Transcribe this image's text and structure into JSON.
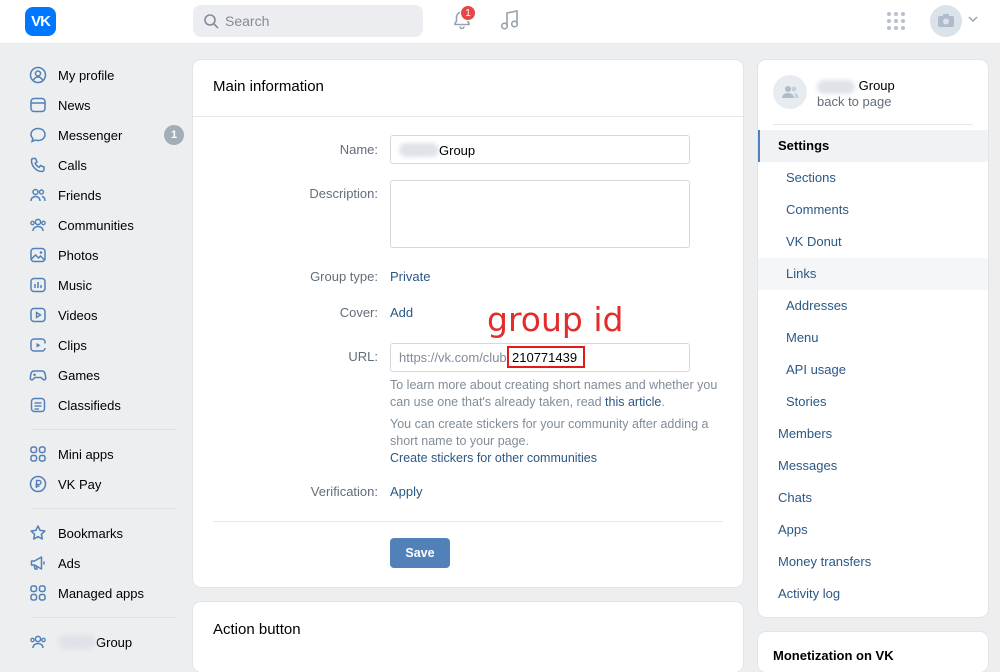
{
  "header": {
    "logo_text": "VK",
    "search_placeholder": "Search",
    "notifications_count": "1"
  },
  "leftnav": {
    "items": [
      {
        "label": "My profile",
        "icon": "profile-icon"
      },
      {
        "label": "News",
        "icon": "news-icon"
      },
      {
        "label": "Messenger",
        "icon": "messenger-icon",
        "count": "1"
      },
      {
        "label": "Calls",
        "icon": "phone-icon"
      },
      {
        "label": "Friends",
        "icon": "friends-icon"
      },
      {
        "label": "Communities",
        "icon": "communities-icon"
      },
      {
        "label": "Photos",
        "icon": "photos-icon"
      },
      {
        "label": "Music",
        "icon": "music-icon"
      },
      {
        "label": "Videos",
        "icon": "videos-icon"
      },
      {
        "label": "Clips",
        "icon": "clips-icon"
      },
      {
        "label": "Games",
        "icon": "games-icon"
      },
      {
        "label": "Classifieds",
        "icon": "classifieds-icon"
      }
    ],
    "items2": [
      {
        "label": "Mini apps",
        "icon": "mini-apps-icon"
      },
      {
        "label": "VK Pay",
        "icon": "vk-pay-icon"
      }
    ],
    "items3": [
      {
        "label": "Bookmarks",
        "icon": "star-icon"
      },
      {
        "label": "Ads",
        "icon": "megaphone-icon"
      },
      {
        "label": "Managed apps",
        "icon": "managed-apps-icon"
      }
    ],
    "group_label": "Group"
  },
  "main": {
    "title": "Main information",
    "name_label": "Name:",
    "name_value": "Group",
    "description_label": "Description:",
    "group_type_label": "Group type:",
    "group_type_value": "Private",
    "cover_label": "Cover:",
    "cover_value": "Add",
    "url_label": "URL:",
    "url_prefix": "https://vk.com/club",
    "url_id": "210771439",
    "help1_text": "To learn more about creating short names and whether you can use one that's already taken, read ",
    "help1_link": "this article",
    "help1_end": ".",
    "help2_text": "You can create stickers for your community after adding a short name to your page.",
    "help2_link": "Create stickers for other communities",
    "verification_label": "Verification:",
    "verification_value": "Apply",
    "save_label": "Save",
    "annotation": "group id"
  },
  "action_card": {
    "title": "Action button"
  },
  "rightnav": {
    "group_name": "Group",
    "back_label": "back to page",
    "items": [
      {
        "label": "Settings",
        "kind": "active"
      },
      {
        "label": "Sections",
        "kind": "sub"
      },
      {
        "label": "Comments",
        "kind": "sub"
      },
      {
        "label": "VK Donut",
        "kind": "sub"
      },
      {
        "label": "Links",
        "kind": "sub"
      },
      {
        "label": "Addresses",
        "kind": "sub"
      },
      {
        "label": "Menu",
        "kind": "sub"
      },
      {
        "label": "API usage",
        "kind": "sub"
      },
      {
        "label": "Stories",
        "kind": "sub"
      },
      {
        "label": "Members",
        "kind": "top"
      },
      {
        "label": "Messages",
        "kind": "top"
      },
      {
        "label": "Chats",
        "kind": "top"
      },
      {
        "label": "Apps",
        "kind": "top"
      },
      {
        "label": "Money transfers",
        "kind": "top"
      },
      {
        "label": "Activity log",
        "kind": "top"
      }
    ],
    "monetization_title": "Monetization on VK"
  },
  "colors": {
    "accent": "#0077ff",
    "link": "#2a5885",
    "annotation": "#e11b1b",
    "button": "#5181b8"
  }
}
